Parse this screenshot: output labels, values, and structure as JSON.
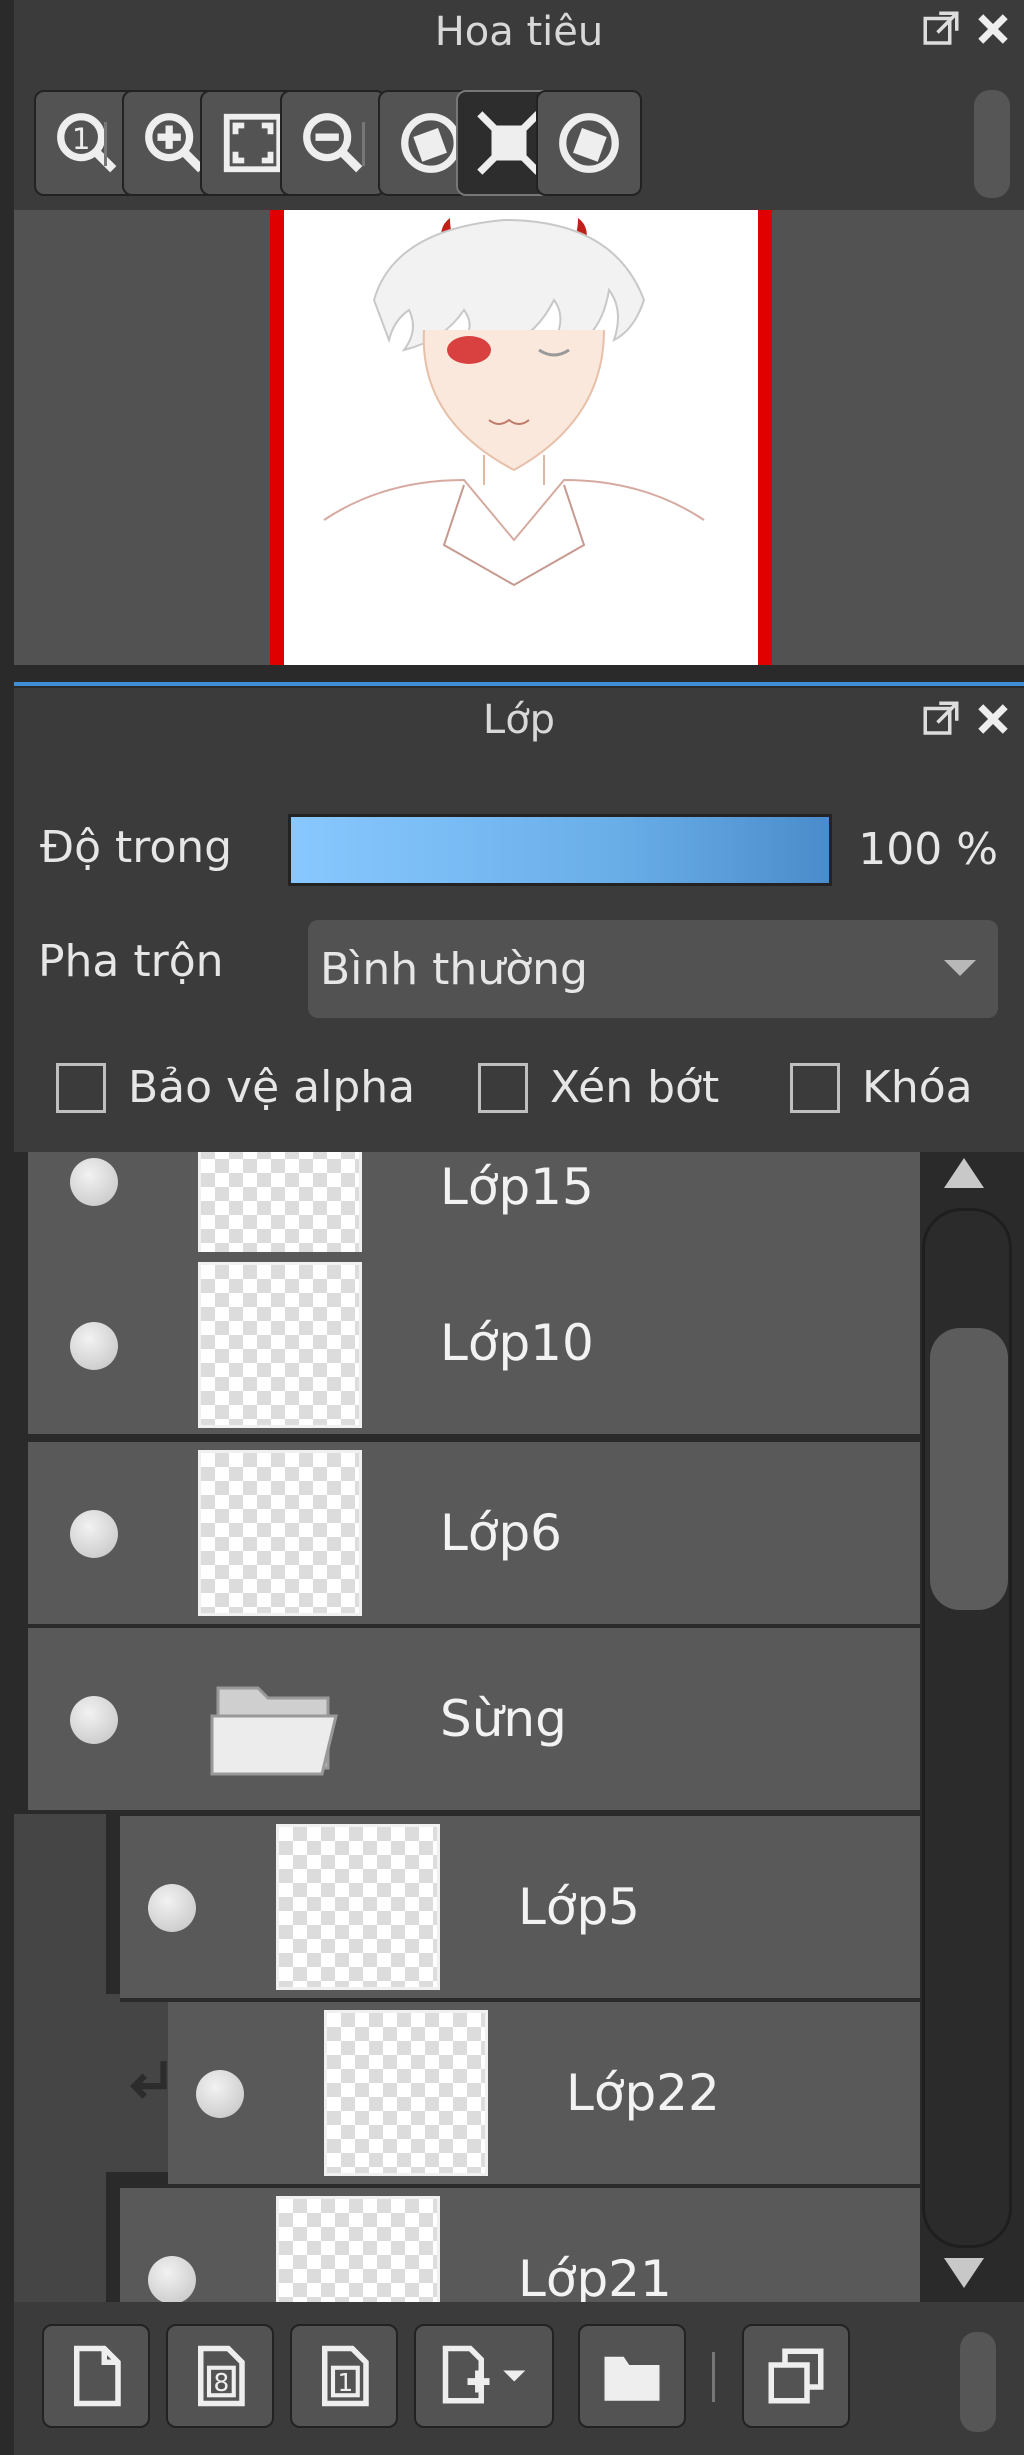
{
  "navigator": {
    "title": "Hoa tiêu",
    "toolbar": [
      {
        "icon": "zoom-actual-size-icon"
      },
      {
        "icon": "zoom-in-icon"
      },
      {
        "icon": "fit-to-window-icon"
      },
      {
        "icon": "zoom-out-icon"
      },
      {
        "icon": "rotate-left-icon"
      },
      {
        "icon": "reset-view-icon"
      },
      {
        "icon": "rotate-right-icon"
      }
    ]
  },
  "layers_panel": {
    "title": "Lớp",
    "opacity_label": "Độ trong",
    "opacity_value": "100 %",
    "opacity_fraction": 1.0,
    "blend_label": "Pha trộn",
    "blend_value": "Bình thường",
    "checkboxes": [
      {
        "label": "Bảo vệ alpha",
        "checked": false
      },
      {
        "label": "Xén bớt",
        "checked": false
      },
      {
        "label": "Khóa",
        "checked": false
      }
    ],
    "layers": [
      {
        "name": "Lớp15",
        "type": "layer",
        "visible": true
      },
      {
        "name": "Lớp10",
        "type": "layer",
        "visible": true
      },
      {
        "name": "Lớp6",
        "type": "layer",
        "visible": true
      },
      {
        "name": "Sừng",
        "type": "folder",
        "visible": true
      },
      {
        "name": "Lớp5",
        "type": "layer",
        "visible": true
      },
      {
        "name": "Lớp22",
        "type": "layer",
        "visible": true,
        "clipped": true
      },
      {
        "name": "Lớp21",
        "type": "layer",
        "visible": true
      }
    ],
    "bottom_toolbar": [
      {
        "icon": "new-layer-icon"
      },
      {
        "icon": "new-8bit-layer-icon"
      },
      {
        "icon": "new-1bit-layer-icon"
      },
      {
        "icon": "add-layer-menu-icon"
      },
      {
        "icon": "new-folder-icon"
      },
      {
        "icon": "duplicate-layer-icon"
      }
    ]
  },
  "colors": {
    "panel_bg": "#3b3b3b",
    "row_bg": "#595959",
    "accent_blue": "#3e8ed6",
    "frame_red": "#e00000"
  }
}
